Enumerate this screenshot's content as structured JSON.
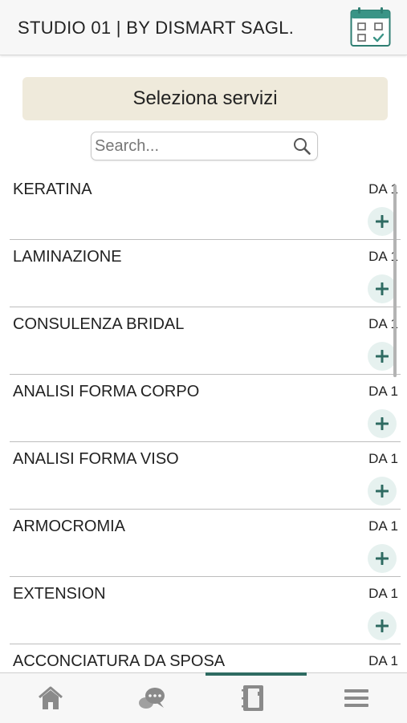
{
  "header": {
    "title": "STUDIO 01 | BY DISMART SAGL.",
    "calendar_icon": "calendar-check-icon"
  },
  "section": {
    "title": "Seleziona servizi"
  },
  "search": {
    "placeholder": "Search...",
    "value": "",
    "icon": "search-icon"
  },
  "services": [
    {
      "name": "KERATINA",
      "price": "DA 1"
    },
    {
      "name": "LAMINAZIONE",
      "price": "DA 1"
    },
    {
      "name": "CONSULENZA BRIDAL",
      "price": "DA 1"
    },
    {
      "name": "ANALISI FORMA CORPO",
      "price": "DA 1"
    },
    {
      "name": "ANALISI FORMA VISO",
      "price": "DA 1"
    },
    {
      "name": "ARMOCROMIA",
      "price": "DA 1"
    },
    {
      "name": "EXTENSION",
      "price": "DA 1"
    },
    {
      "name": "ACCONCIATURA DA SPOSA",
      "price": "DA 1"
    }
  ],
  "tabbar": {
    "tabs": [
      {
        "icon": "home-icon"
      },
      {
        "icon": "chat-icon"
      },
      {
        "icon": "notebook-icon",
        "active": true
      },
      {
        "icon": "menu-icon"
      }
    ]
  },
  "colors": {
    "accent": "#2e6b62",
    "section_bg": "#efeadb",
    "button_bg": "#e6f1ef"
  }
}
